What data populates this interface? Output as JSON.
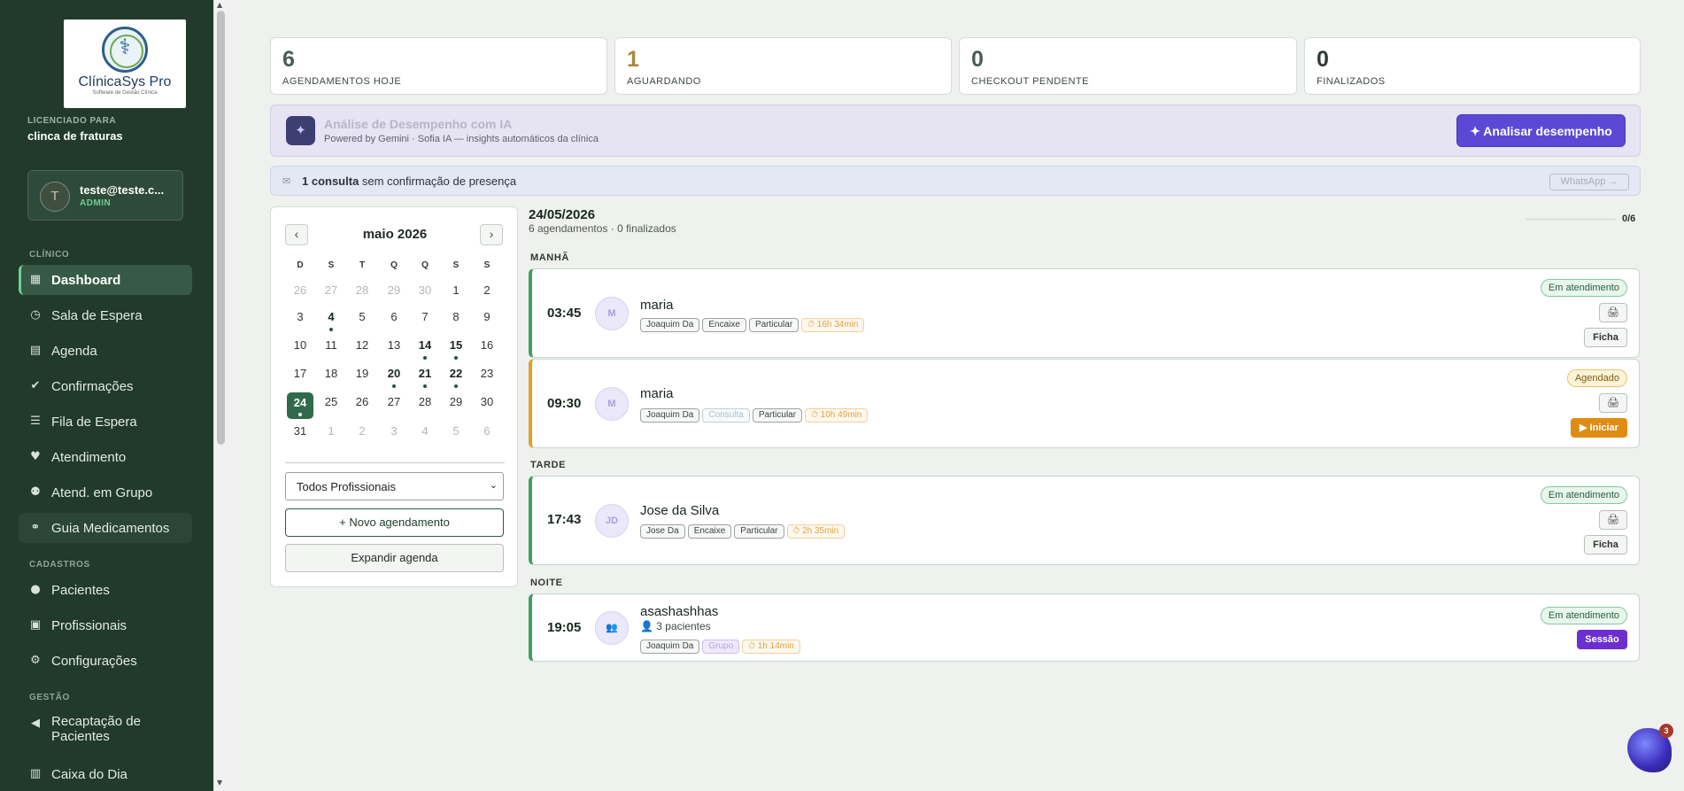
{
  "brand": {
    "name": "ClínicaSys Pro",
    "tagline": "Software de Gestão Clínica"
  },
  "license": {
    "label": "LICENCIADO PARA",
    "name": "clinca de fraturas"
  },
  "user": {
    "initial": "T",
    "email": "teste@teste.c...",
    "role": "ADMIN"
  },
  "sidebar": {
    "sections": {
      "clinico": "CLÍNICO",
      "cadastros": "CADASTROS",
      "gestao": "GESTÃO"
    },
    "items": [
      {
        "label": "Dashboard",
        "icon": "grid-icon"
      },
      {
        "label": "Sala de Espera",
        "icon": "clock-icon"
      },
      {
        "label": "Agenda",
        "icon": "calendar-icon"
      },
      {
        "label": "Confirmações",
        "icon": "check-circle-icon"
      },
      {
        "label": "Fila de Espera",
        "icon": "list-check-icon"
      },
      {
        "label": "Atendimento",
        "icon": "heart-pulse-icon"
      },
      {
        "label": "Atend. em Grupo",
        "icon": "users-icon"
      },
      {
        "label": "Guia Medicamentos",
        "icon": "pills-icon"
      },
      {
        "label": "Pacientes",
        "icon": "user-icon"
      },
      {
        "label": "Profissionais",
        "icon": "id-card-icon"
      },
      {
        "label": "Configurações",
        "icon": "gear-icon"
      },
      {
        "label": "Recaptação de Pacientes",
        "icon": "megaphone-icon"
      },
      {
        "label": "Caixa do Dia",
        "icon": "cash-register-icon"
      }
    ]
  },
  "stats": [
    {
      "value": "6",
      "label": "AGENDAMENTOS HOJE",
      "color": "#4a5d50"
    },
    {
      "value": "1",
      "label": "AGUARDANDO",
      "color": "#a8873a"
    },
    {
      "value": "0",
      "label": "CHECKOUT PENDENTE",
      "color": "#4a5d50"
    },
    {
      "value": "0",
      "label": "FINALIZADOS",
      "color": "#2f3b34"
    }
  ],
  "ai": {
    "title": "Análise de Desempenho com IA",
    "subtitle": "Powered by Gemini · Sofia IA — insights automáticos da clínica",
    "button": "✦ Analisar desempenho"
  },
  "alert": {
    "count": "1 consulta",
    "text": " sem confirmação de presença",
    "button": "WhatsApp →"
  },
  "calendar": {
    "month": "maio 2026",
    "prev": "‹",
    "next": "›",
    "weekdays": [
      "D",
      "S",
      "T",
      "Q",
      "Q",
      "S",
      "S"
    ],
    "weeks": [
      [
        {
          "d": "26",
          "m": true
        },
        {
          "d": "27",
          "m": true
        },
        {
          "d": "28",
          "m": true
        },
        {
          "d": "29",
          "m": true
        },
        {
          "d": "30",
          "m": true
        },
        {
          "d": "1"
        },
        {
          "d": "2"
        }
      ],
      [
        {
          "d": "3"
        },
        {
          "d": "4",
          "b": true,
          "dot": true
        },
        {
          "d": "5"
        },
        {
          "d": "6"
        },
        {
          "d": "7"
        },
        {
          "d": "8"
        },
        {
          "d": "9"
        }
      ],
      [
        {
          "d": "10"
        },
        {
          "d": "11"
        },
        {
          "d": "12"
        },
        {
          "d": "13"
        },
        {
          "d": "14",
          "b": true,
          "dot": true
        },
        {
          "d": "15",
          "b": true,
          "dot": true
        },
        {
          "d": "16"
        }
      ],
      [
        {
          "d": "17"
        },
        {
          "d": "18"
        },
        {
          "d": "19"
        },
        {
          "d": "20",
          "b": true,
          "dot": true
        },
        {
          "d": "21",
          "b": true,
          "dot": true
        },
        {
          "d": "22",
          "b": true,
          "dot": true
        },
        {
          "d": "23"
        }
      ],
      [
        {
          "d": "24",
          "sel": true,
          "dot": true
        },
        {
          "d": "25"
        },
        {
          "d": "26"
        },
        {
          "d": "27"
        },
        {
          "d": "28"
        },
        {
          "d": "29"
        },
        {
          "d": "30"
        }
      ],
      [
        {
          "d": "31"
        },
        {
          "d": "1",
          "m": true
        },
        {
          "d": "2",
          "m": true
        },
        {
          "d": "3",
          "m": true
        },
        {
          "d": "4",
          "m": true
        },
        {
          "d": "5",
          "m": true
        },
        {
          "d": "6",
          "m": true
        }
      ]
    ],
    "professional_select": "Todos Profissionais",
    "new_button": "+ Novo agendamento",
    "expand_button": "Expandir agenda"
  },
  "day": {
    "date": "24/05/2026",
    "summary": "6 agendamentos · 0 finalizados",
    "progress": "0/6",
    "progress_fraction": 0
  },
  "periods": {
    "morning": "MANHÃ",
    "afternoon": "TARDE",
    "night": "NOITE"
  },
  "appointments": [
    {
      "time": "03:45",
      "initials": "M",
      "name": "maria",
      "tags": [
        "Joaquim Da",
        "Encaixe",
        "Particular"
      ],
      "elapsed": "⏱ 16h 34min",
      "status": "Em atendimento",
      "action": "Ficha"
    },
    {
      "time": "09:30",
      "initials": "M",
      "name": "maria",
      "tags": [
        "Joaquim Da",
        "Consulta",
        "Particular"
      ],
      "elapsed": "⏱ 10h 49min",
      "status": "Agendado",
      "action": "▶ Iniciar"
    },
    {
      "time": "17:43",
      "initials": "JD",
      "name": "Jose da Silva",
      "tags": [
        "Jose Da",
        "Encaixe",
        "Particular"
      ],
      "elapsed": "⏱ 2h 35min",
      "status": "Em atendimento",
      "action": "Ficha"
    },
    {
      "time": "19:05",
      "initials": "👥",
      "name": "asashashhas",
      "patients": "👤 3 pacientes",
      "tags": [
        "Joaquim Da",
        "Grupo"
      ],
      "elapsed": "⏱ 1h 14min",
      "status": "Em atendimento",
      "action": "Sessão"
    }
  ],
  "print_icon": "🖨",
  "chat": {
    "badge": "3"
  }
}
